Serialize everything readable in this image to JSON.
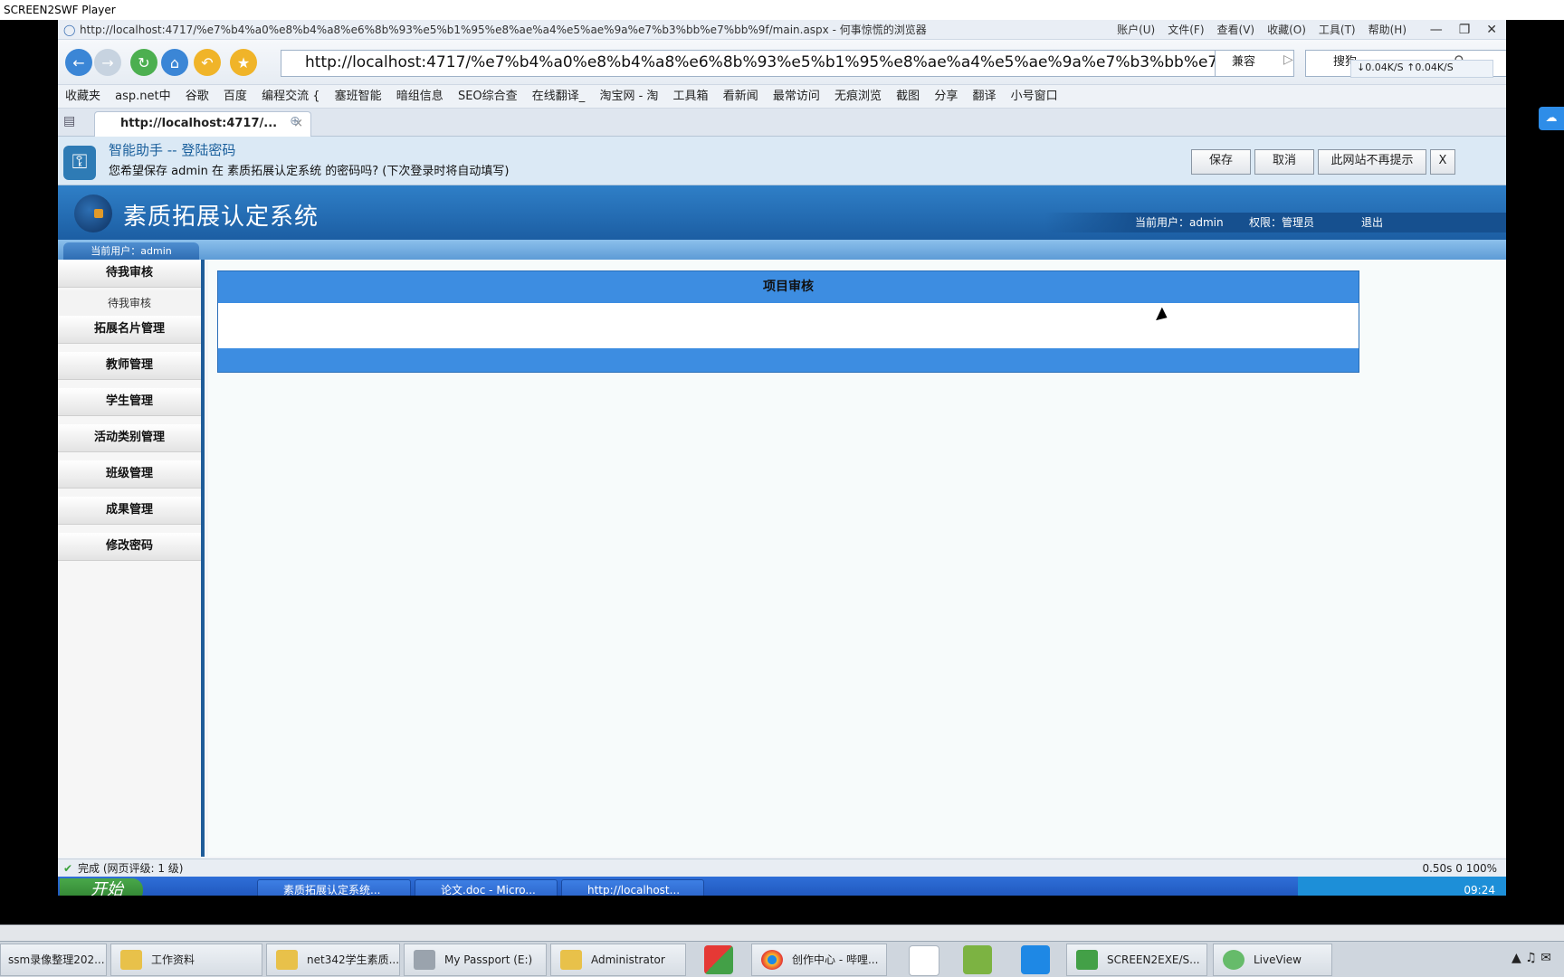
{
  "player": {
    "title": "SCREEN2SWF Player"
  },
  "browser": {
    "title_url": "http://localhost:4717/%e7%b4%a0%e8%b4%a8%e6%8b%93%e5%b1%95%e8%ae%a4%e5%ae%9a%e7%b3%bb%e7%bb%9f/main.aspx - 何事惊慌的浏览器",
    "menus": [
      "账户(U)",
      "文件(F)",
      "查看(V)",
      "收藏(O)",
      "工具(T)",
      "帮助(H)"
    ],
    "address": "http://localhost:4717/%e7%b4%a0%e8%b4%a8%e6%8b%93%e5%b1%95%e8%ae%a4%e5%ae%9a%e7%b3%bb%e7%bb%9f",
    "compat_label": "兼容",
    "search_placeholder": "搜狗",
    "speed": "↓0.04K/S ↑0.04K/S",
    "favorites": [
      "收藏夹",
      "asp.net中",
      "谷歌",
      "百度",
      "编程交流 {",
      "塞班智能",
      "暗组信息",
      "SEO综合查",
      "在线翻译_",
      "淘宝网 - 淘",
      "工具箱",
      "看新闻",
      "最常访问",
      "无痕浏览",
      "截图",
      "分享",
      "翻译",
      "小号窗口"
    ],
    "tab_title": "http://localhost:4717/...",
    "status_text": "完成 (网页评级: 1 级)",
    "status_right": "0.50s    0    100%"
  },
  "password_bar": {
    "title": "智能助手 -- 登陆密码",
    "message": "您希望保存 admin 在 素质拓展认定系统 的密码吗? (下次登录时将自动填写)",
    "save_label": "保存",
    "cancel_label": "取消",
    "never_label": "此网站不再提示",
    "close_label": "X"
  },
  "app": {
    "title": "素质拓展认定系统",
    "current_user": "当前用户：admin",
    "role": "权限：管理员",
    "logout": "退出",
    "strip_user": "当前用户：admin"
  },
  "sidebar": {
    "items": [
      {
        "label": "待我审核"
      },
      {
        "label": "待我审核"
      },
      {
        "label": "拓展名片管理"
      },
      {
        "label": "教师管理"
      },
      {
        "label": "学生管理"
      },
      {
        "label": "活动类别管理"
      },
      {
        "label": "班级管理"
      },
      {
        "label": "成果管理"
      },
      {
        "label": "修改密码"
      }
    ]
  },
  "content": {
    "table_title": "项目审核"
  },
  "taskbar_inner": {
    "start": "开始",
    "items": [
      "素质拓展认定系统...",
      "论文.doc - Micro...",
      "http://localhost..."
    ],
    "time": "09:24"
  },
  "taskbar_outer": {
    "items": [
      "ssm录像整理202...",
      "工作资料",
      "net342学生素质...",
      "My Passport (E:)",
      "Administrator",
      "创作中心 - 哔哩...",
      "SCREEN2EXE/S...",
      "LiveView"
    ]
  },
  "colors": {
    "header_blue": "#1c5ea3",
    "table_blue": "#3d8de1",
    "side_border": "#1f5c99"
  }
}
